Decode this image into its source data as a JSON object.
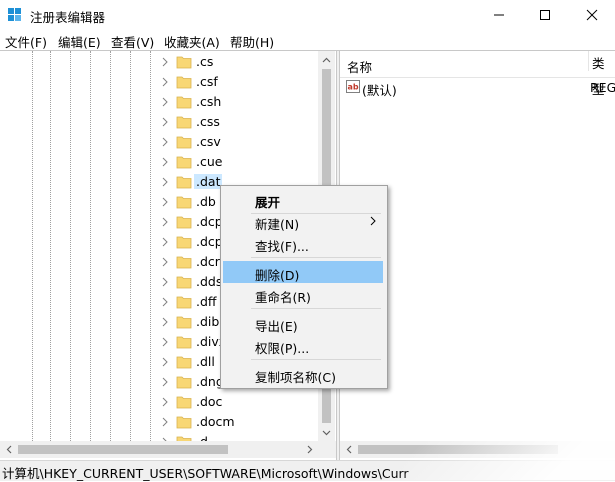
{
  "window": {
    "title": "注册表编辑器",
    "minimize_glyph": "—",
    "maximize_glyph": "☐",
    "close_glyph": "✕"
  },
  "menu": [
    "文件(F)",
    "编辑(E)",
    "查看(V)",
    "收藏夹(A)",
    "帮助(H)"
  ],
  "tree": {
    "items": [
      ".cs",
      ".csf",
      ".csh",
      ".css",
      ".csv",
      ".cue",
      ".dat",
      ".db",
      ".dcp",
      ".dcp",
      ".dcr",
      ".dds",
      ".dff",
      ".dib",
      ".divx",
      ".dll",
      ".dng",
      ".doc",
      ".docm",
      ".d"
    ],
    "selected_index": 6
  },
  "list": {
    "columns": {
      "name": "名称",
      "type": "类型"
    },
    "rows": [
      {
        "name": "(默认)",
        "type": "REG"
      }
    ]
  },
  "context_menu": {
    "items": [
      {
        "label": "展开",
        "bold": true
      },
      {
        "label": "新建(N)",
        "submenu": true
      },
      {
        "label": "查找(F)..."
      },
      {
        "label": "删除(D)",
        "highlighted": true
      },
      {
        "label": "重命名(R)"
      },
      {
        "label": "导出(E)"
      },
      {
        "label": "权限(P)..."
      },
      {
        "label": "复制项名称(C)"
      }
    ]
  },
  "status": {
    "path": "计算机\\HKEY_CURRENT_USER\\SOFTWARE\\Microsoft\\Windows\\Curr"
  },
  "colors": {
    "folder": "#f8d775",
    "highlight": "#91c9f7",
    "selection": "#cce8ff"
  }
}
